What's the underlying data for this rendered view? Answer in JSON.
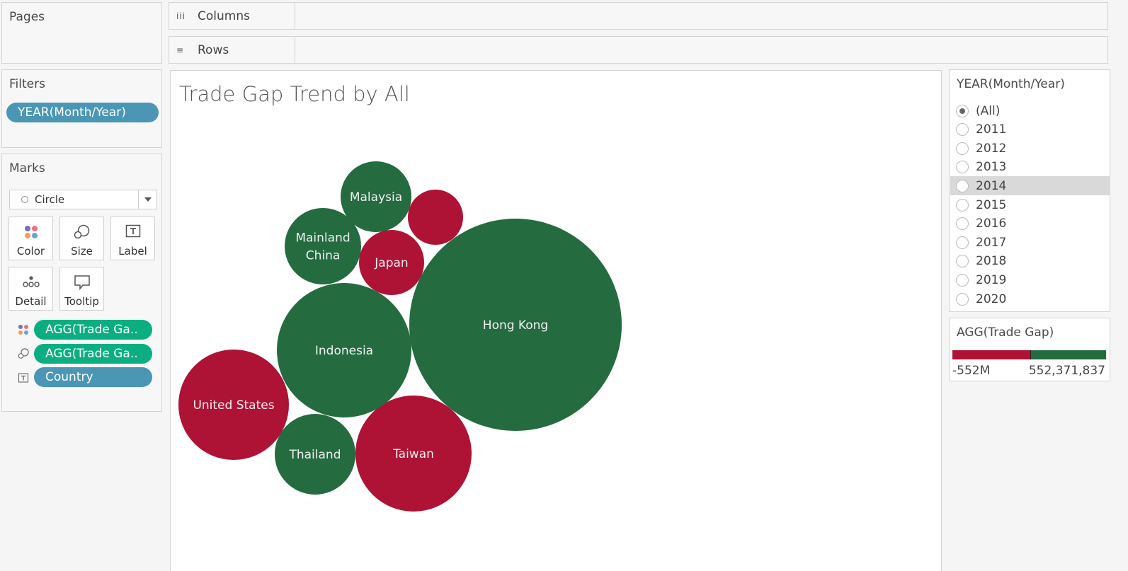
{
  "shelves": {
    "pages_title": "Pages",
    "columns_label": "Columns",
    "rows_label": "Rows"
  },
  "filters": {
    "title": "Filters",
    "pills": [
      "YEAR(Month/Year)"
    ]
  },
  "marks": {
    "title": "Marks",
    "mark_type": "Circle",
    "buttons": {
      "color": "Color",
      "size": "Size",
      "label": "Label",
      "detail": "Detail",
      "tooltip": "Tooltip"
    },
    "fields": [
      {
        "text": "AGG(Trade Ga..",
        "kind": "color-icon",
        "style": "green"
      },
      {
        "text": "AGG(Trade Ga..",
        "kind": "size-icon",
        "style": "green"
      },
      {
        "text": "Country",
        "kind": "label-icon",
        "style": "blue"
      }
    ]
  },
  "viz": {
    "title": "Trade Gap Trend by All"
  },
  "colors": {
    "negative": "#ae1235",
    "positive": "#246b40",
    "pill_blue": "#4a96b4",
    "pill_green": "#0aae81"
  },
  "chart_data": {
    "type": "packed-bubble",
    "title": "Trade Gap Trend by All",
    "size_measure": "AGG(Trade Gap)",
    "color_measure": "AGG(Trade Gap)",
    "label_field": "Country",
    "bubbles": [
      {
        "label": "Hong Kong",
        "sign": "positive"
      },
      {
        "label": "Taiwan",
        "sign": "negative"
      },
      {
        "label": "Indonesia",
        "sign": "positive"
      },
      {
        "label": "United States",
        "sign": "negative"
      },
      {
        "label": "Thailand",
        "sign": "positive"
      },
      {
        "label": "Mainland China",
        "sign": "positive"
      },
      {
        "label": "Malaysia",
        "sign": "positive"
      },
      {
        "label": "Japan",
        "sign": "negative"
      },
      {
        "label": "",
        "sign": "negative"
      }
    ]
  },
  "year_filter": {
    "title": "YEAR(Month/Year)",
    "options": [
      "(All)",
      "2011",
      "2012",
      "2013",
      "2014",
      "2015",
      "2016",
      "2017",
      "2018",
      "2019",
      "2020"
    ],
    "selected": "(All)",
    "hovered": "2014"
  },
  "color_legend": {
    "title": "AGG(Trade Gap)",
    "min_label": "-552M",
    "max_label": "552,371,837"
  }
}
